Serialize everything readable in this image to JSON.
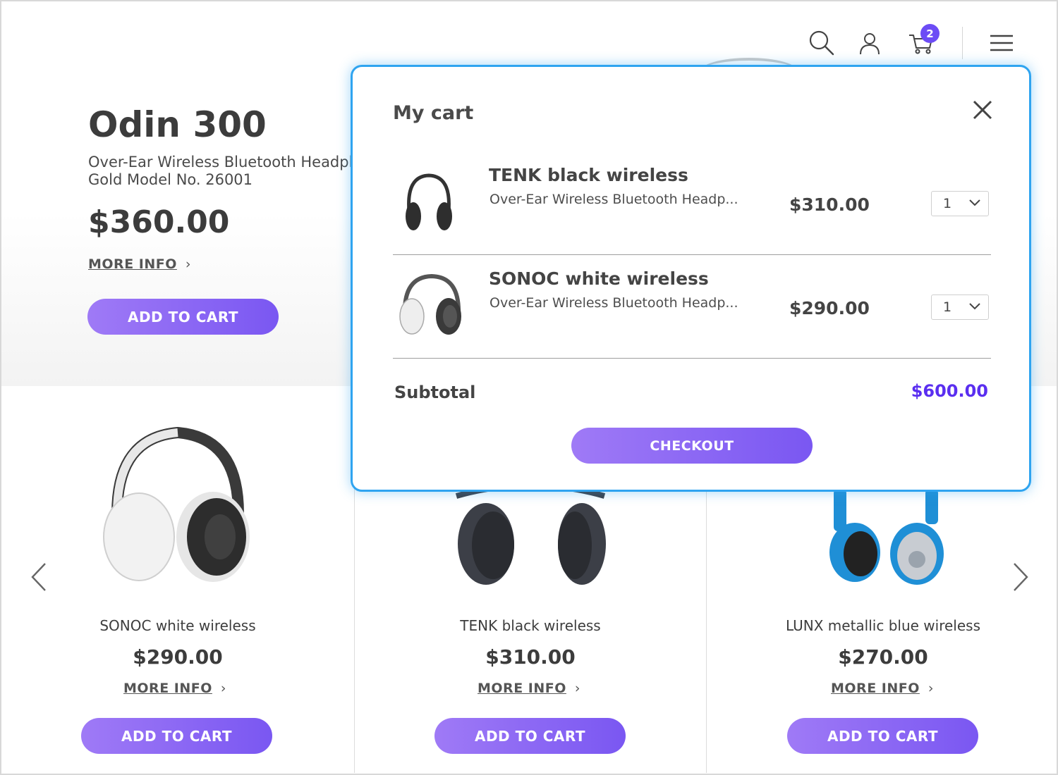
{
  "header": {
    "icons": [
      "search-icon",
      "user-icon",
      "cart-icon",
      "menu-icon"
    ],
    "cart_count": "2"
  },
  "hero": {
    "title": "Odin 300",
    "subtitle_line1": "Over-Ear Wireless Bluetooth Headphones",
    "subtitle_line2": "Gold Model No. 26001",
    "price": "$360.00",
    "more_info": "MORE INFO",
    "add_to_cart": "ADD TO CART"
  },
  "products": [
    {
      "name": "SONOC white wireless",
      "price": "$290.00",
      "more_info": "MORE INFO",
      "add_to_cart": "ADD TO CART"
    },
    {
      "name": "TENK black wireless",
      "price": "$310.00",
      "more_info": "MORE INFO",
      "add_to_cart": "ADD TO CART"
    },
    {
      "name": "LUNX metallic blue wireless",
      "price": "$270.00",
      "more_info": "MORE INFO",
      "add_to_cart": "ADD TO CART"
    }
  ],
  "cart": {
    "title": "My cart",
    "items": [
      {
        "name": "TENK black wireless",
        "description": "Over-Ear Wireless Bluetooth Headp...",
        "price": "$310.00",
        "qty": "1"
      },
      {
        "name": "SONOC white wireless",
        "description": "Over-Ear Wireless Bluetooth Headp...",
        "price": "$290.00",
        "qty": "1"
      }
    ],
    "subtotal_label": "Subtotal",
    "subtotal_value": "$600.00",
    "checkout": "CHECKOUT"
  },
  "colors": {
    "accent": "#7a57f2",
    "accent_light": "#9f7af6",
    "popup_border": "#2fa4f0",
    "subtotal": "#5a2ef0",
    "lunx_blue": "#1f8fd6"
  }
}
